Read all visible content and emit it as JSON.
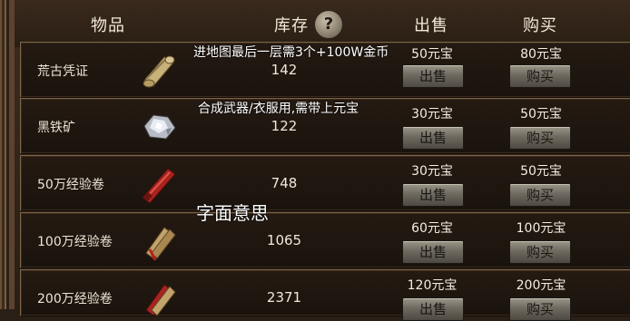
{
  "header": {
    "item": "物品",
    "stock": "库存",
    "sell": "出售",
    "buy": "购买",
    "help": "?"
  },
  "items": [
    {
      "name": "荒古凭证",
      "stock": "142",
      "sell_price": "50元宝",
      "buy_price": "80元宝",
      "sell_label": "出售",
      "buy_label": "购买",
      "icon": "scroll-icon"
    },
    {
      "name": "黑铁矿",
      "stock": "122",
      "sell_price": "30元宝",
      "buy_price": "50元宝",
      "sell_label": "出售",
      "buy_label": "购买",
      "icon": "ore-icon"
    },
    {
      "name": "50万经验卷",
      "stock": "748",
      "sell_price": "30元宝",
      "buy_price": "50元宝",
      "sell_label": "出售",
      "buy_label": "购买",
      "icon": "red-scroll-icon"
    },
    {
      "name": "100万经验卷",
      "stock": "1065",
      "sell_price": "60元宝",
      "buy_price": "100元宝",
      "sell_label": "出售",
      "buy_label": "购买",
      "icon": "bundle-scroll-icon"
    },
    {
      "name": "200万经验卷",
      "stock": "2371",
      "sell_price": "120元宝",
      "buy_price": "200元宝",
      "sell_label": "出售",
      "buy_label": "购买",
      "icon": "red-bundle-icon"
    }
  ],
  "annotations": {
    "note1": "进地图最后一层需3个+100W金币",
    "note2": "合成武器/衣服用,需带上元宝",
    "note3": "字面意思"
  },
  "colors": {
    "background": "#2a1f16",
    "text": "#f2ecd8",
    "button": "#8a8478"
  }
}
